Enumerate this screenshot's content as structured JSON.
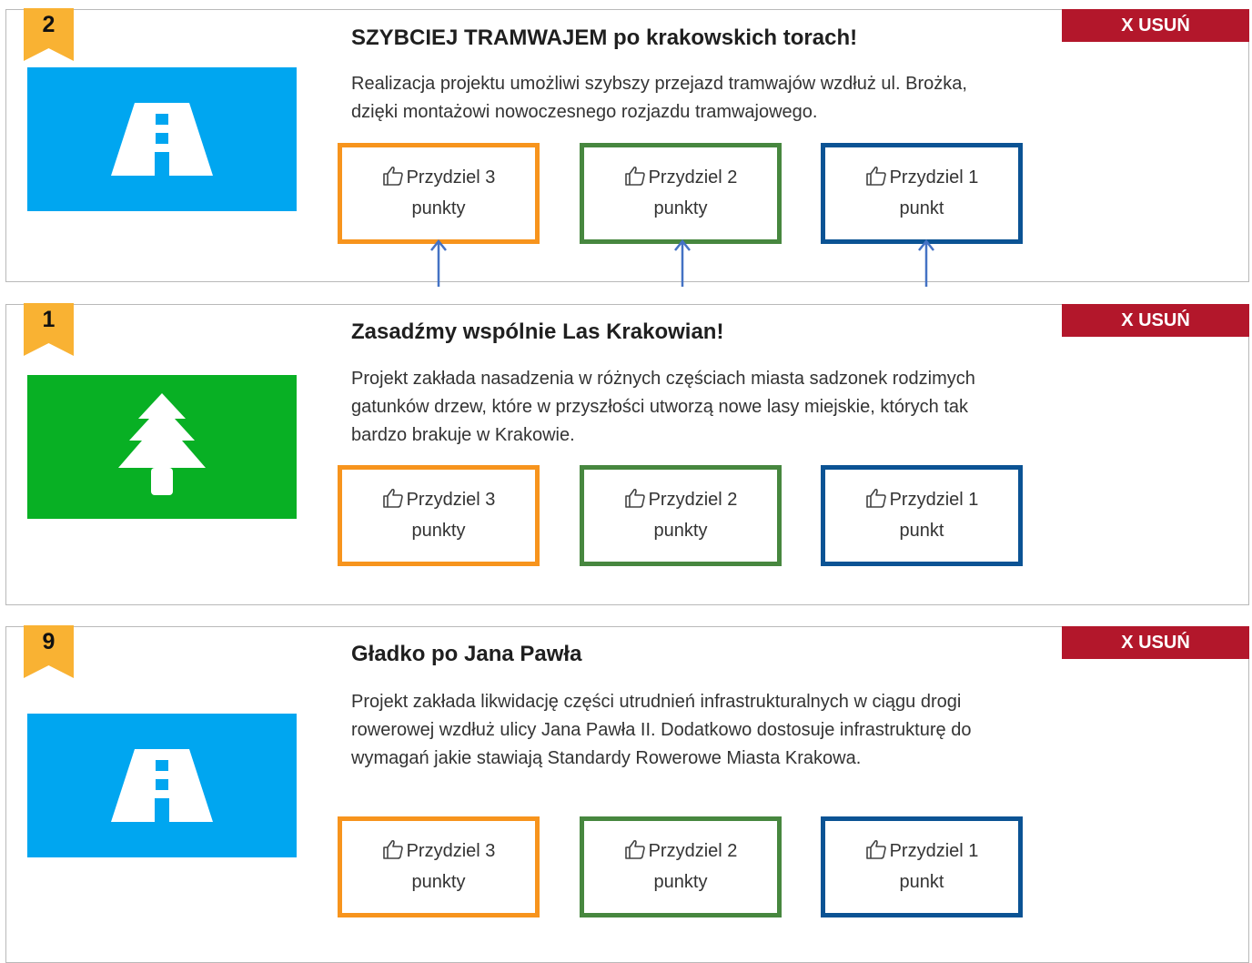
{
  "remove_label": "X USUŃ",
  "vote_buttons": {
    "three": {
      "line1": "Przydziel 3",
      "line2": "punkty"
    },
    "two": {
      "line1": "Przydziel 2",
      "line2": "punkty"
    },
    "one": {
      "line1": "Przydziel 1",
      "line2": "punkt"
    }
  },
  "projects": [
    {
      "rank": "2",
      "icon": "road-icon",
      "thumb_color": "#00a6f0",
      "title": "SZYBCIEJ TRAMWAJEM po krakowskich torach!",
      "description": "Realizacja projektu umożliwi szybszy przejazd tramwajów wzdłuż ul. Brożka, dzięki montażowi nowoczesnego rozjazdu tramwajowego."
    },
    {
      "rank": "1",
      "icon": "tree-icon",
      "thumb_color": "#08b024",
      "title": "Zasadźmy wspólnie Las Krakowian!",
      "description": "Projekt zakłada nasadzenia w różnych częściach miasta sadzonek rodzimych gatunków drzew, które w przyszłości utworzą nowe lasy miejskie, których tak bardzo brakuje w Krakowie."
    },
    {
      "rank": "9",
      "icon": "road-icon",
      "thumb_color": "#00a6f0",
      "title": "Gładko po Jana Pawła",
      "description": "Projekt zakłada likwidację części utrudnień infrastrukturalnych w ciągu drogi rowerowej wzdłuż ulicy Jana Pawła II. Dodatkowo dostosuje infrastrukturę do wymagań jakie stawiają Standardy Rowerowe Miasta Krakowa."
    }
  ],
  "colors": {
    "badge": "#f9b233",
    "remove": "#b3172b",
    "vote3": "#f7941d",
    "vote2": "#47873f",
    "vote1": "#0b5394",
    "arrow": "#4472c4"
  }
}
